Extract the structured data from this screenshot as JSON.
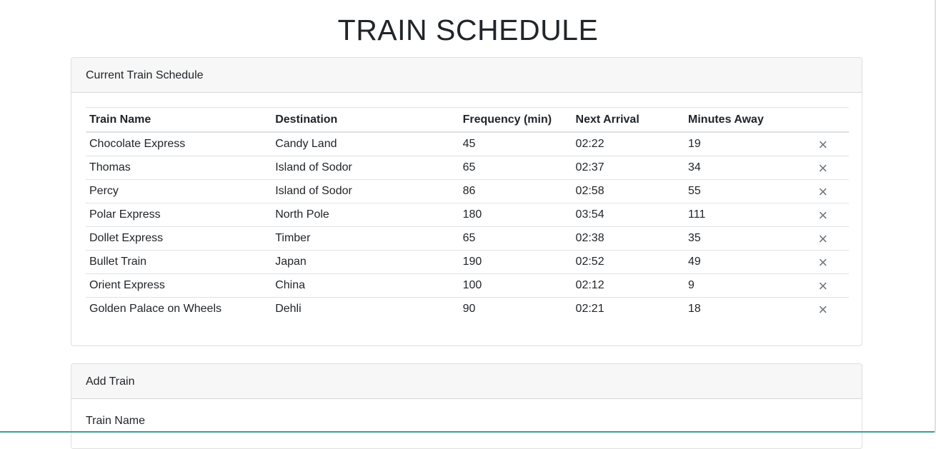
{
  "page": {
    "title": "TRAIN SCHEDULE"
  },
  "schedule": {
    "header": "Current Train Schedule",
    "columns": [
      "Train Name",
      "Destination",
      "Frequency (min)",
      "Next Arrival",
      "Minutes Away"
    ],
    "delete_icon": "×",
    "rows": [
      {
        "name": "Chocolate Express",
        "destination": "Candy Land",
        "frequency": "45",
        "next_arrival": "02:22",
        "minutes_away": "19"
      },
      {
        "name": "Thomas",
        "destination": "Island of Sodor",
        "frequency": "65",
        "next_arrival": "02:37",
        "minutes_away": "34"
      },
      {
        "name": "Percy",
        "destination": "Island of Sodor",
        "frequency": "86",
        "next_arrival": "02:58",
        "minutes_away": "55"
      },
      {
        "name": "Polar Express",
        "destination": "North Pole",
        "frequency": "180",
        "next_arrival": "03:54",
        "minutes_away": "111"
      },
      {
        "name": "Dollet Express",
        "destination": "Timber",
        "frequency": "65",
        "next_arrival": "02:38",
        "minutes_away": "35"
      },
      {
        "name": "Bullet Train",
        "destination": "Japan",
        "frequency": "190",
        "next_arrival": "02:52",
        "minutes_away": "49"
      },
      {
        "name": "Orient Express",
        "destination": "China",
        "frequency": "100",
        "next_arrival": "02:12",
        "minutes_away": "9"
      },
      {
        "name": "Golden Palace on Wheels",
        "destination": "Dehli",
        "frequency": "90",
        "next_arrival": "02:21",
        "minutes_away": "18"
      }
    ]
  },
  "add_train": {
    "header": "Add Train",
    "train_name_label": "Train Name"
  },
  "colors": {
    "accent_bottom": "#3c9d9b",
    "card_header_bg": "#f7f7f7"
  }
}
